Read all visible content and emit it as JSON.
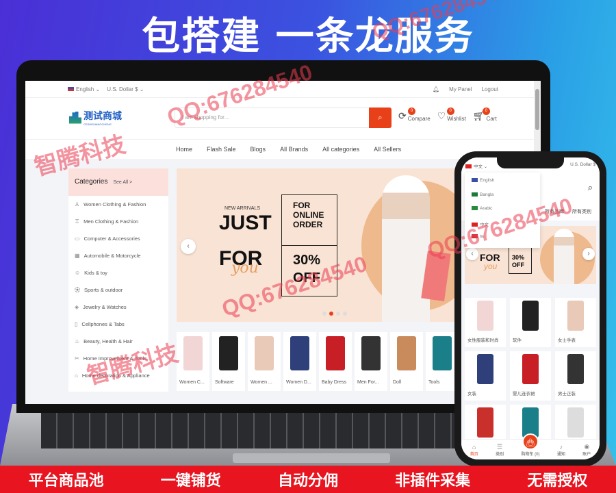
{
  "headline": "包搭建 一条龙服务",
  "desktop": {
    "topbar": {
      "language": "English",
      "currency": "U.S. Dollar $",
      "my_panel": "My Panel",
      "logout": "Logout"
    },
    "logo": {
      "text": "测试商城",
      "subtext": "CESHISHANGCHENG"
    },
    "search": {
      "placeholder": "I am shopping for..."
    },
    "header_icons": [
      {
        "label": "Compare",
        "count": "0"
      },
      {
        "label": "Wishlist",
        "count": "0"
      },
      {
        "label": "Cart",
        "count": "0"
      }
    ],
    "nav": [
      "Home",
      "Flash Sale",
      "Blogs",
      "All Brands",
      "All categories",
      "All Sellers"
    ],
    "categories": {
      "title": "Categories",
      "see_all": "See All >",
      "items": [
        "Women Clothing & Fashion",
        "Men Clothing & Fashion",
        "Computer & Accessories",
        "Automobile & Motorcycle",
        "Kids & toy",
        "Sports & outdoor",
        "Jewelry & Watches",
        "Cellphones & Tabs",
        "Beauty, Health & Hair",
        "Home Improvement & Tools",
        "Home decoration & Appliance"
      ]
    },
    "banner": {
      "kicker": "NEW ARRIVALS",
      "line1": "JUST",
      "line2": "FOR",
      "script": "you",
      "box_top": "FOR ONLINE ORDER",
      "box_bottom": "30% OFF",
      "active_slide": 2,
      "slides": 4
    },
    "products": [
      "Women C...",
      "Software",
      "Women ...",
      "Women D...",
      "Baby Dress",
      "Men For...",
      "Doll",
      "Tools"
    ]
  },
  "mobile": {
    "language": "中文",
    "currency": "U.S. Dollar $",
    "language_options": [
      "English",
      "Bangla",
      "Arabic",
      "中文",
      "tw"
    ],
    "tabs": [
      "所有品牌",
      "所有类别"
    ],
    "banner": {
      "line": "FOR",
      "script": "you",
      "box": "30% OFF"
    },
    "grid": [
      "女性服装和时尚",
      "软件",
      "女士手表",
      "女装",
      "婴儿连衣裙",
      "男士正装",
      "",
      "",
      ""
    ],
    "bottom_nav": [
      "首页",
      "类别",
      "购物车 (0)",
      "通知",
      "账户"
    ]
  },
  "features": [
    "平台商品池",
    "一键铺货",
    "自动分佣",
    "非插件采集",
    "无需授权"
  ],
  "watermarks": {
    "qq": "QQ:676284540",
    "brand": "智腾科技"
  },
  "colors": {
    "accent": "#e8411a",
    "footer": "#e8141f",
    "category_header": "#fbe0dc"
  }
}
